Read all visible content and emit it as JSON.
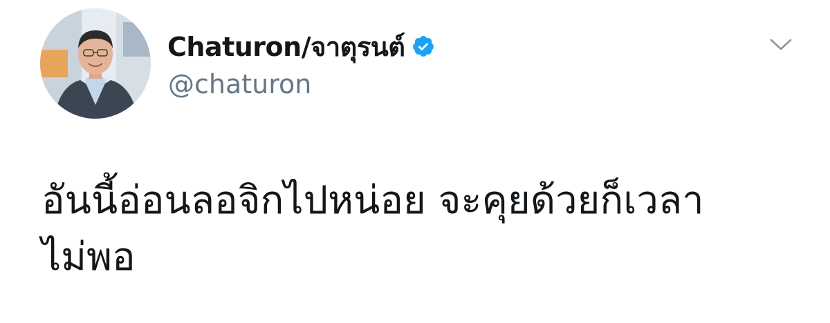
{
  "tweet": {
    "display_name": "Chaturon/จาตุรนต์",
    "handle": "@chaturon",
    "verified": true,
    "text_lines": [
      "อันนี้อ่อนลอจิกไปหน่อย จะคุยด้วยก็เวลา",
      "ไม่พอ"
    ]
  },
  "icons": {
    "avatar": "profile-photo",
    "verified": "verified-badge-icon",
    "menu": "chevron-down-icon"
  },
  "colors": {
    "text": "#14171a",
    "secondary_text": "#657786",
    "verified_blue": "#1da1f2",
    "background": "#ffffff"
  }
}
